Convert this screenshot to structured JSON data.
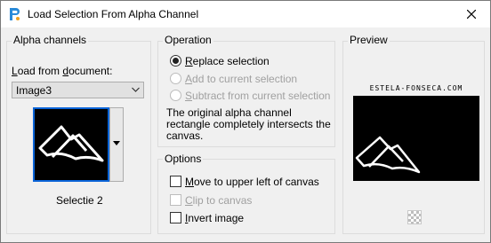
{
  "window": {
    "title": "Load Selection From Alpha Channel"
  },
  "alpha_channels": {
    "title": "Alpha channels",
    "load_label": "Load from document:",
    "document_value": "Image3",
    "channel_name": "Selectie 2"
  },
  "operation": {
    "title": "Operation",
    "replace_label": "Replace selection",
    "add_label": "Add to current selection",
    "subtract_label": "Subtract from current selection",
    "selected": "Replace selection",
    "note": "The original alpha channel rectangle completely intersects the canvas."
  },
  "options": {
    "title": "Options",
    "move_label": "Move to upper left of canvas",
    "clip_label": "Clip to canvas",
    "invert_label": "Invert image",
    "move_checked": false,
    "clip_checked": false,
    "invert_checked": false
  },
  "preview": {
    "title": "Preview",
    "watermark": "ESTELA-FONSECA.COM"
  },
  "icons": {
    "app": "app-icon",
    "close": "close-icon",
    "dropdown": "chevron-down-icon",
    "transparency": "transparency-checker-icon"
  },
  "colors": {
    "selection_border": "#0a64d8",
    "preview_background": "#000000"
  }
}
